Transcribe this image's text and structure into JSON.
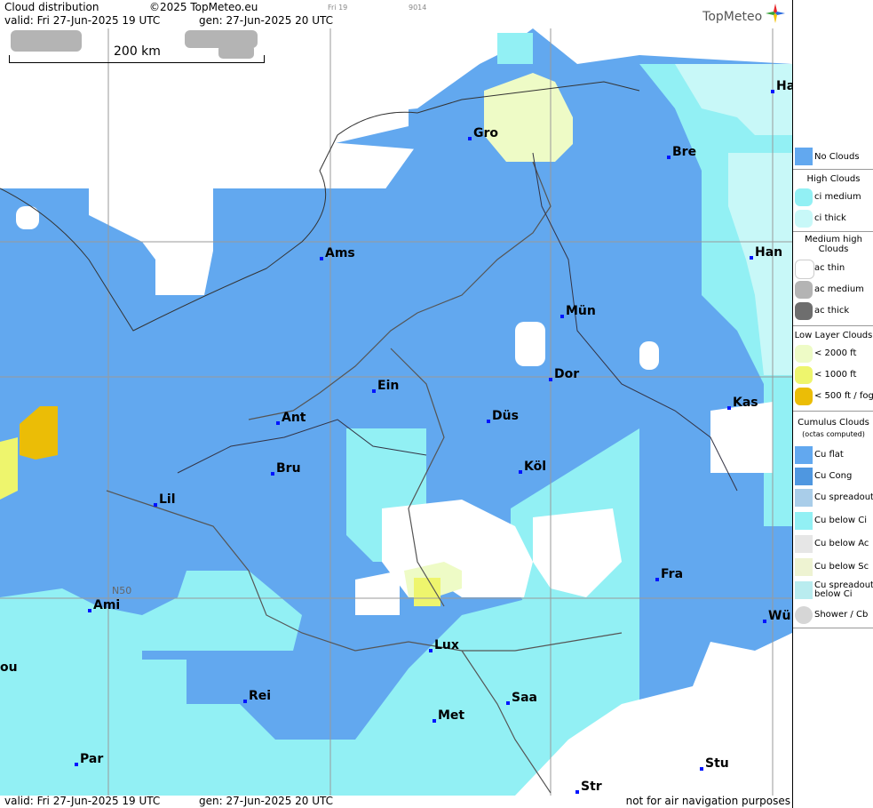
{
  "header": {
    "title": "Cloud distribution",
    "copyright": "©2025 TopMeteo.eu",
    "tag_day": "Fri 19",
    "tag_code": "9014",
    "valid": "valid:  Fri  27-Jun-2025  19 UTC",
    "gen": "gen: 27-Jun-2025 20 UTC",
    "logo": "TopMeteo"
  },
  "footer": {
    "valid": "valid:  Fri  27-Jun-2025  19 UTC",
    "gen": "gen: 27-Jun-2025 20 UTC",
    "note": "not for air navigation purposes"
  },
  "map": {
    "scale_label": "200 km",
    "lat_label": "N50",
    "cities": [
      {
        "name": "Gro"
      },
      {
        "name": "Bre"
      },
      {
        "name": "Ha"
      },
      {
        "name": "Ams"
      },
      {
        "name": "Han"
      },
      {
        "name": "Mün"
      },
      {
        "name": "Dor"
      },
      {
        "name": "Ein"
      },
      {
        "name": "Kas"
      },
      {
        "name": "Ant"
      },
      {
        "name": "Düs"
      },
      {
        "name": "Bru"
      },
      {
        "name": "Köl"
      },
      {
        "name": "Lil"
      },
      {
        "name": "Fra"
      },
      {
        "name": "Ami"
      },
      {
        "name": "Wü"
      },
      {
        "name": "Lux"
      },
      {
        "name": "ou"
      },
      {
        "name": "Rei"
      },
      {
        "name": "Saa"
      },
      {
        "name": "Met"
      },
      {
        "name": "Stu"
      },
      {
        "name": "Par"
      },
      {
        "name": "Str"
      }
    ],
    "colors": {
      "no_clouds": "#62a8ef",
      "ci_medium": "#92f0f4",
      "ci_thick": "#c8f8f8",
      "ac_thin": "#ffffff",
      "low_2000": "#eefbc6",
      "low_1000": "#eef56d",
      "low_500": "#ebbd06"
    }
  },
  "legend": {
    "no_clouds": "No Clouds",
    "high_clouds": "High Clouds",
    "ci_medium": "ci medium",
    "ci_thick": "ci thick",
    "medium_high_1": "Medium high",
    "medium_high_2": "Clouds",
    "ac_thin": "ac thin",
    "ac_medium": "ac medium",
    "ac_thick": "ac thick",
    "low_layer": "Low Layer Clouds",
    "low_2000": "< 2000 ft",
    "low_1000": "< 1000 ft",
    "low_500": "< 500 ft / fog",
    "cumulus": "Cumulus Clouds",
    "cumulus_sub": "(octas computed)",
    "cu_flat": "Cu flat",
    "cu_cong": "Cu Cong",
    "cu_spreadout": "Cu spreadout",
    "cu_below_ci": "Cu below Ci",
    "cu_below_ac": "Cu below Ac",
    "cu_below_sc": "Cu below Sc",
    "cu_spread_ci_1": "Cu spreadout",
    "cu_spread_ci_2": "below Ci",
    "shower": "Shower / Cb"
  }
}
